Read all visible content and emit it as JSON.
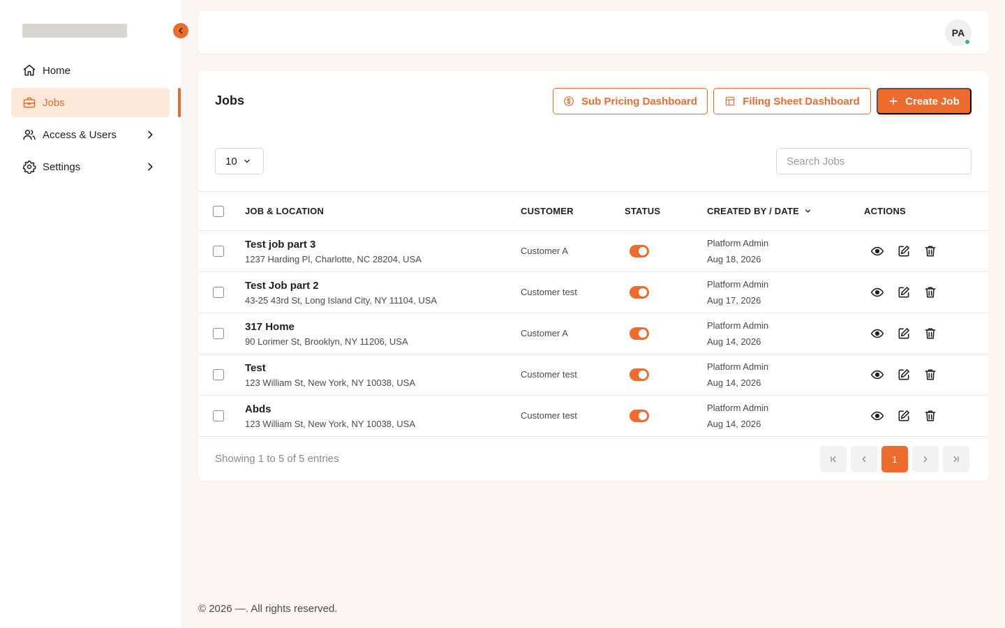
{
  "sidebar": {
    "items": [
      {
        "label": "Home",
        "icon": "home-icon"
      },
      {
        "label": "Jobs",
        "icon": "briefcase-icon",
        "active": true
      },
      {
        "label": "Access & Users",
        "icon": "users-icon"
      },
      {
        "label": "Settings",
        "icon": "gear-icon"
      }
    ]
  },
  "header": {
    "avatar_initials": "PA"
  },
  "jobs": {
    "title": "Jobs",
    "sub_pricing_label": "Sub Pricing Dashboard",
    "filing_sheet_label": "Filing Sheet Dashboard",
    "create_label": "Create Job",
    "page_size": "10",
    "search_placeholder": "Search Jobs"
  },
  "table": {
    "columns": [
      "JOB & LOCATION",
      "CUSTOMER",
      "STATUS",
      "CREATED BY / DATE",
      "ACTIONS"
    ],
    "rows": [
      {
        "name": "Test job part 3",
        "address": "1237 Harding Pl, Charlotte, NC 28204, USA",
        "customer": "Customer A",
        "created_by": "Platform Admin",
        "date": "Aug 18, 2026",
        "status_on": true
      },
      {
        "name": "Test Job part 2",
        "address": "43-25 43rd St, Long Island City, NY 11104, USA",
        "customer": "Customer test",
        "created_by": "Platform Admin",
        "date": "Aug 17, 2026",
        "status_on": true
      },
      {
        "name": "317 Home",
        "address": "90 Lorimer St, Brooklyn, NY 11206, USA",
        "customer": "Customer A",
        "created_by": "Platform Admin",
        "date": "Aug 14, 2026",
        "status_on": true
      },
      {
        "name": "Test",
        "address": "123 William St, New York, NY 10038, USA",
        "customer": "Customer test",
        "created_by": "Platform Admin",
        "date": "Aug 14, 2026",
        "status_on": true
      },
      {
        "name": "Abds",
        "address": "123 William St, New York, NY 10038, USA",
        "customer": "Customer test",
        "created_by": "Platform Admin",
        "date": "Aug 14, 2026",
        "status_on": true
      }
    ]
  },
  "pagination": {
    "info": "Showing 1 to 5 of 5 entries",
    "current_page": "1"
  },
  "footer": {
    "copyright": "© 2026 —. All rights reserved."
  },
  "colors": {
    "accent": "#ec6b2d",
    "active_bg": "#fde7d8",
    "page_bg": "#fbf6f1",
    "online": "#36b37e"
  }
}
